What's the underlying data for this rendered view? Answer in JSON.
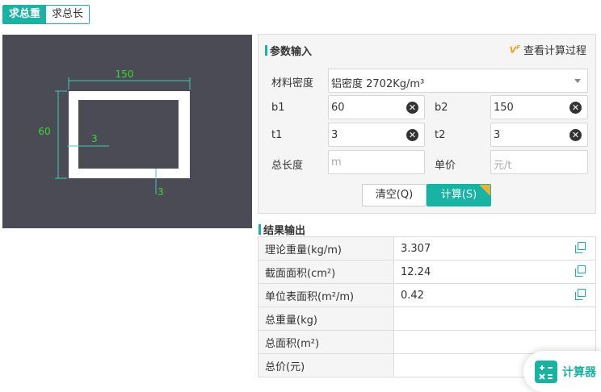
{
  "tabs": [
    {
      "label": "求总重",
      "active": true
    },
    {
      "label": "求总长",
      "active": false
    }
  ],
  "drawing": {
    "width_label": "150",
    "height_label": "60",
    "t1_label": "3",
    "t2_label": "3"
  },
  "params": {
    "title": "参数输入",
    "view_process": "查看计算过程",
    "material_label": "材料密度",
    "material_value": "铝密度 2702Kg/m³",
    "b1_label": "b1",
    "b1_value": "60",
    "b2_label": "b2",
    "b2_value": "150",
    "t1_label": "t1",
    "t1_value": "3",
    "t2_label": "t2",
    "t2_value": "3",
    "length_label": "总长度",
    "length_placeholder": "m",
    "price_label": "单价",
    "price_placeholder": "元/t",
    "clear_button": "清空(Q)",
    "calc_button": "计算(S)"
  },
  "results": {
    "title": "结果输出",
    "rows": [
      {
        "key": "理论重量(kg/m)",
        "value": "3.307",
        "copyable": true
      },
      {
        "key": "截面面积(cm²)",
        "value": "12.24",
        "copyable": true
      },
      {
        "key": "单位表面积(m²/m)",
        "value": "0.42",
        "copyable": true
      },
      {
        "key": "总重量(kg)",
        "value": "",
        "copyable": false
      },
      {
        "key": "总面积(m²)",
        "value": "",
        "copyable": false
      },
      {
        "key": "总价(元)",
        "value": "",
        "copyable": false
      }
    ]
  },
  "floating": {
    "label": "计算器",
    "icon": "calculator-icon"
  },
  "colors": {
    "accent": "#17b3a3",
    "drawing_bg": "#4a4b55",
    "dim_line": "#3ec8b6",
    "dim_text": "#39d830"
  }
}
